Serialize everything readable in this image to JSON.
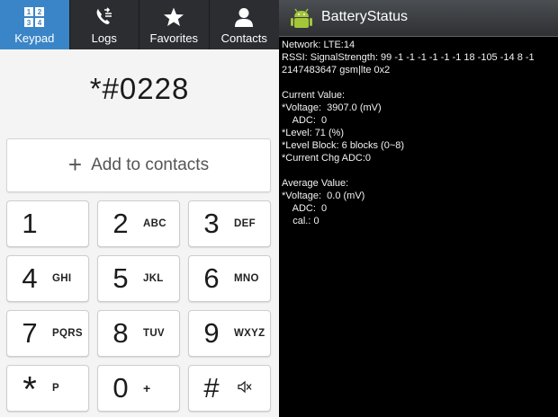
{
  "dialer": {
    "tabs": [
      {
        "label": "Keypad",
        "icon": "keypad-icon",
        "active": true
      },
      {
        "label": "Logs",
        "icon": "call-log-icon",
        "active": false
      },
      {
        "label": "Favorites",
        "icon": "star-icon",
        "active": false
      },
      {
        "label": "Contacts",
        "icon": "person-icon",
        "active": false
      }
    ],
    "keypad_icon_digits": [
      "1",
      "2",
      "3",
      "4"
    ],
    "number": "*#0228",
    "add_to_contacts": "Add to contacts",
    "add_icon": "+",
    "keys": [
      {
        "digit": "1",
        "letters": ""
      },
      {
        "digit": "2",
        "letters": "ABC"
      },
      {
        "digit": "3",
        "letters": "DEF"
      },
      {
        "digit": "4",
        "letters": "GHI"
      },
      {
        "digit": "5",
        "letters": "JKL"
      },
      {
        "digit": "6",
        "letters": "MNO"
      },
      {
        "digit": "7",
        "letters": "PQRS"
      },
      {
        "digit": "8",
        "letters": "TUV"
      },
      {
        "digit": "9",
        "letters": "WXYZ"
      },
      {
        "digit": "*",
        "letters": "P"
      },
      {
        "digit": "0",
        "letters": "+"
      },
      {
        "digit": "#",
        "letters": "",
        "icon": "mute-icon"
      }
    ],
    "colors": {
      "tab_active": "#3a85c7",
      "tabbar": "#2b2d30",
      "background": "#f4f4f4"
    }
  },
  "battery_app": {
    "title": "BatteryStatus",
    "icon": "android-icon",
    "lines": [
      "Network: LTE:14",
      "RSSI: SignalStrength: 99 -1 -1 -1 -1 -1 -1 18 -105 -14 8 -1",
      "2147483647 gsm|lte 0x2",
      "",
      "Current Value:",
      "*Voltage:  3907.0 (mV)",
      "    ADC:  0",
      "*Level: 71 (%)",
      "*Level Block: 6 blocks (0~8)",
      "*Current Chg ADC:0",
      "",
      "Average Value:",
      "*Voltage:  0.0 (mV)",
      "    ADC:  0",
      "    cal.: 0"
    ],
    "colors": {
      "background": "#000000",
      "text": "#f2f2f2"
    }
  }
}
